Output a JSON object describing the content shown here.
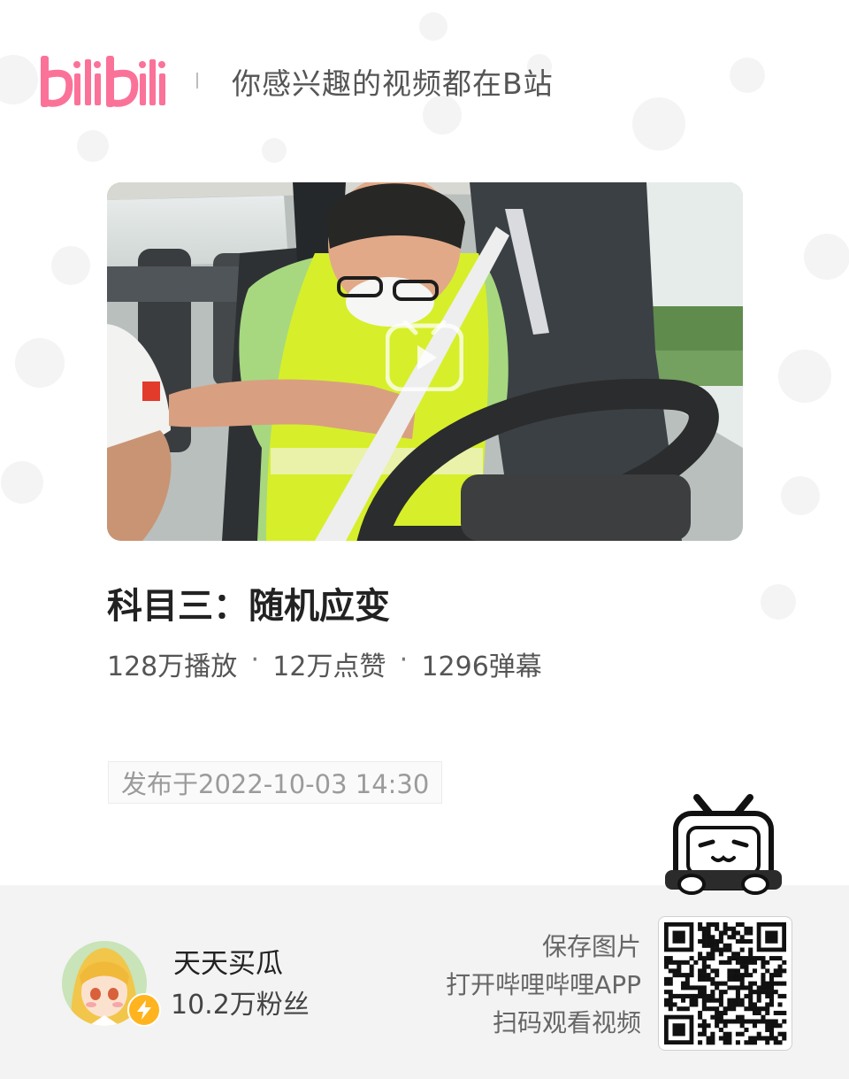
{
  "header": {
    "logo_text": "bilibili",
    "slogan": "你感兴趣的视频都在B站"
  },
  "video": {
    "title": "科目三：随机应变",
    "stats": {
      "plays": "128万播放",
      "likes": "12万点赞",
      "danmaku": "1296弹幕"
    },
    "published": "发布于2022-10-03 14:30"
  },
  "author": {
    "name": "天天买瓜",
    "fans": "10.2万粉丝"
  },
  "cta": {
    "line1": "保存图片",
    "line2": "打开哔哩哔哩APP",
    "line3": "扫码观看视频"
  },
  "colors": {
    "brand_pink": "#fb7299",
    "bolt_badge": "#ffb41f",
    "footer_bg": "#f3f3f3"
  },
  "icons": {
    "play": "play-icon",
    "bolt": "lightning-bolt-icon",
    "mascot": "bilibili-tv-mascot-icon",
    "qr": "qr-code"
  }
}
